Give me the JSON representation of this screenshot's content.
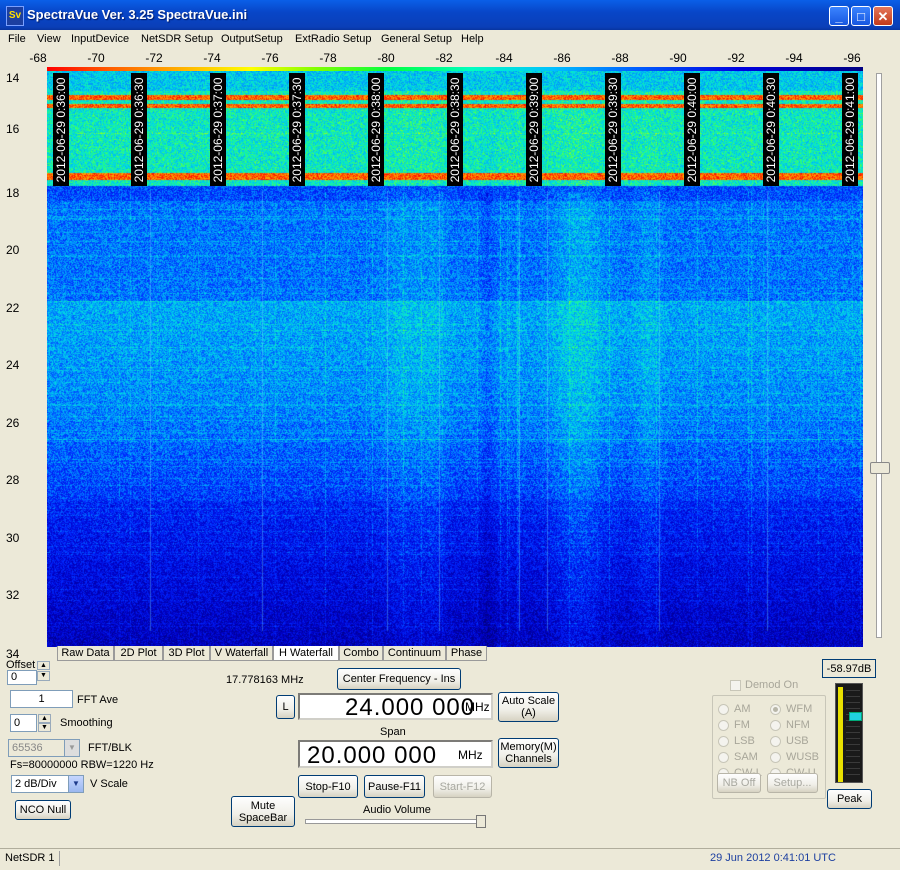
{
  "window": {
    "icon_text": "Sv",
    "title": "SpectraVue Ver. 3.25  SpectraVue.ini",
    "minimize_glyph": "_",
    "maximize_glyph": "□",
    "close_glyph": "✕"
  },
  "menu": [
    "File",
    "View",
    "InputDevice",
    "NetSDR Setup",
    "OutputSetup",
    "ExtRadio Setup",
    "General Setup",
    "Help"
  ],
  "spectrum": {
    "x_ticks": [
      "-68",
      "-70",
      "-72",
      "-74",
      "-76",
      "-78",
      "-80",
      "-82",
      "-84",
      "-86",
      "-88",
      "-90",
      "-92",
      "-94",
      "-96"
    ],
    "y_ticks": [
      "14",
      "16",
      "18",
      "20",
      "22",
      "24",
      "26",
      "28",
      "30",
      "32",
      "34"
    ],
    "timestamps": [
      "2012-06-29 0:36:00",
      "2012-06-29 0:36:30",
      "2012-06-29 0:37:00",
      "2012-06-29 0:37:30",
      "2012-06-29 0:38:00",
      "2012-06-29 0:38:30",
      "2012-06-29 0:39:00",
      "2012-06-29 0:39:30",
      "2012-06-29 0:40:00",
      "2012-06-29 0:40:30",
      "2012-06-29 0:41:00"
    ]
  },
  "tabs": [
    "Raw Data",
    "2D Plot",
    "3D Plot",
    "V Waterfall",
    "H Waterfall",
    "Combo",
    "Continuum",
    "Phase"
  ],
  "active_tab": "H Waterfall",
  "controls": {
    "offset_label": "Offset",
    "offset_value": "0",
    "fft_ave_value": "1",
    "fft_ave_label": "FFT Ave",
    "smoothing_value": "0",
    "smoothing_label": "Smoothing",
    "fft_blk_value": "65536",
    "fft_blk_label": "FFT/BLK",
    "fs_rbw": "Fs=80000000 RBW=1220 Hz",
    "vscale_value": "2 dB/Div",
    "vscale_label": "V Scale",
    "nco_null": "NCO Null",
    "mute": "Mute\nSpaceBar",
    "cursor_freq": "17.778163 MHz",
    "center_freq_button": "Center Frequency - Ins",
    "l_button": "L",
    "center_freq_value": "24.000 000",
    "center_freq_unit": "MHz",
    "auto_scale": "Auto Scale\n(A)",
    "span_label": "Span",
    "span_value": "20.000 000",
    "span_unit": "MHz",
    "memory": "Memory(M)\nChannels",
    "stop": "Stop-F10",
    "pause": "Pause-F11",
    "start": "Start-F12",
    "audio_volume": "Audio Volume"
  },
  "demod": {
    "checkbox_label": "Demod On",
    "modes_left": [
      "AM",
      "FM",
      "LSB",
      "SAM",
      "CW-L"
    ],
    "modes_right": [
      "WFM",
      "NFM",
      "USB",
      "WUSB",
      "CW-U"
    ],
    "selected": "WFM",
    "nb_off": "NB Off",
    "setup": "Setup..."
  },
  "meter": {
    "level_readout": "-58.97dB",
    "peak_button": "Peak"
  },
  "status": {
    "left": "NetSDR 1",
    "right": "29 Jun 2012  0:41:01 UTC"
  }
}
